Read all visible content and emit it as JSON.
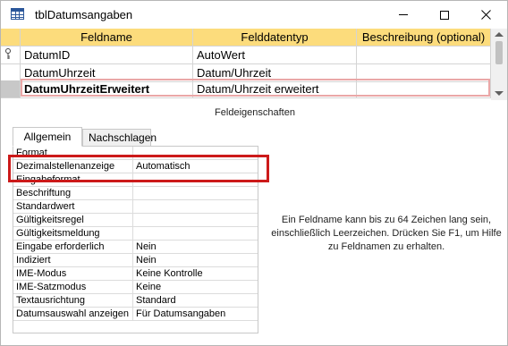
{
  "window": {
    "title": "tblDatumsangaben",
    "icon": "table-icon",
    "controls": [
      "minimize",
      "maximize",
      "close"
    ]
  },
  "grid": {
    "headers": [
      "Feldname",
      "Felddatentyp",
      "Beschreibung (optional)"
    ],
    "rows": [
      {
        "name": "DatumID",
        "type": "AutoWert",
        "description": "",
        "primary_key": true,
        "selected": false
      },
      {
        "name": "DatumUhrzeit",
        "type": "Datum/Uhrzeit",
        "description": "",
        "primary_key": false,
        "selected": false
      },
      {
        "name": "DatumUhrzeitErweitert",
        "type": "Datum/Uhrzeit erweitert",
        "description": "",
        "primary_key": false,
        "selected": true
      }
    ]
  },
  "field_properties": {
    "section_label": "Feldeigenschaften",
    "tabs": [
      "Allgemein",
      "Nachschlagen"
    ],
    "active_tab": "Allgemein",
    "rows": [
      {
        "label": "Format",
        "value": ""
      },
      {
        "label": "Dezimalstellenanzeige",
        "value": "Automatisch"
      },
      {
        "label": "Eingabeformat",
        "value": ""
      },
      {
        "label": "Beschriftung",
        "value": ""
      },
      {
        "label": "Standardwert",
        "value": ""
      },
      {
        "label": "Gültigkeitsregel",
        "value": ""
      },
      {
        "label": "Gültigkeitsmeldung",
        "value": ""
      },
      {
        "label": "Eingabe erforderlich",
        "value": "Nein"
      },
      {
        "label": "Indiziert",
        "value": "Nein"
      },
      {
        "label": "IME-Modus",
        "value": "Keine Kontrolle"
      },
      {
        "label": "IME-Satzmodus",
        "value": "Keine"
      },
      {
        "label": "Textausrichtung",
        "value": "Standard"
      },
      {
        "label": "Datumsauswahl anzeigen",
        "value": "Für Datumsangaben"
      }
    ],
    "help_text": "Ein Feldname kann bis zu 64 Zeichen lang sein, einschließlich Leerzeichen. Drücken Sie F1, um Hilfe zu Feldnamen zu erhalten."
  },
  "colors": {
    "header_bg": "#fcdc7c",
    "highlight": "#cc1a1a",
    "selection_outline": "#eaa7a7"
  }
}
